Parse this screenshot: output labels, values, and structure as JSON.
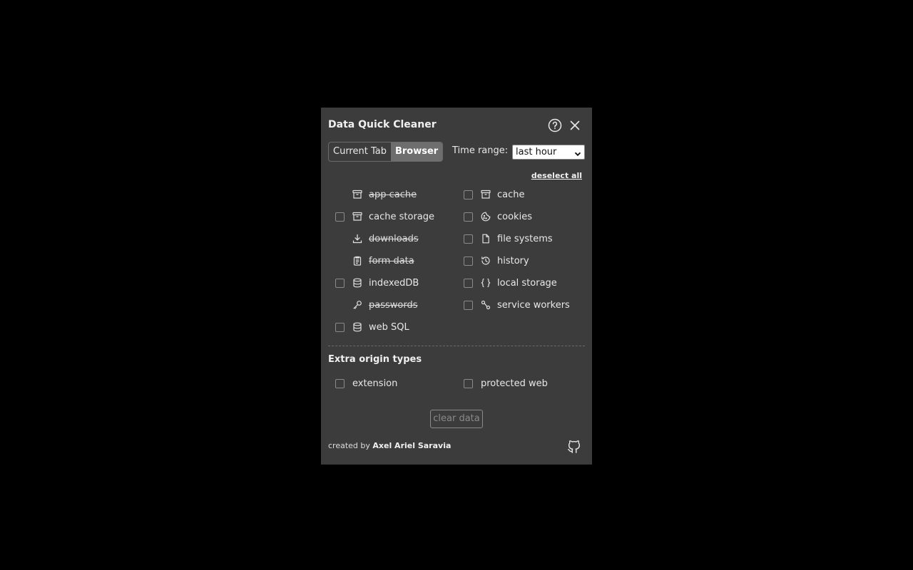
{
  "header": {
    "title": "Data Quick Cleaner"
  },
  "tabs": [
    {
      "label": "Current Tab",
      "active": false
    },
    {
      "label": "Browser",
      "active": true
    }
  ],
  "time_range": {
    "label": "Time range:",
    "selected": "last hour"
  },
  "deselect_all": "deselect all",
  "items": {
    "app_cache": {
      "label": "app cache",
      "icon": "archive-icon",
      "disabled": true
    },
    "cache": {
      "label": "cache",
      "icon": "archive-icon",
      "checked": false
    },
    "cache_storage": {
      "label": "cache storage",
      "icon": "archive-icon",
      "checked": false
    },
    "cookies": {
      "label": "cookies",
      "icon": "cookie-icon",
      "checked": false
    },
    "downloads": {
      "label": "downloads",
      "icon": "download-icon",
      "disabled": true
    },
    "file_systems": {
      "label": "file systems",
      "icon": "file-icon",
      "checked": false
    },
    "form_data": {
      "label": "form data",
      "icon": "clipboard-icon",
      "disabled": true
    },
    "history": {
      "label": "history",
      "icon": "history-icon",
      "checked": false
    },
    "indexeddb": {
      "label": "indexedDB",
      "icon": "database-icon",
      "checked": false
    },
    "local_storage": {
      "label": "local storage",
      "icon": "braces-icon",
      "checked": false
    },
    "passwords": {
      "label": "passwords",
      "icon": "key-icon",
      "disabled": true
    },
    "service_workers": {
      "label": "service workers",
      "icon": "route-icon",
      "checked": false
    },
    "web_sql": {
      "label": "web SQL",
      "icon": "database-icon",
      "checked": false
    }
  },
  "extra": {
    "title": "Extra origin types",
    "extension": "extension",
    "protected_web": "protected web"
  },
  "clear_button": "clear data",
  "footer": {
    "prefix": "created by",
    "author": "Axel Ariel Saravia"
  }
}
